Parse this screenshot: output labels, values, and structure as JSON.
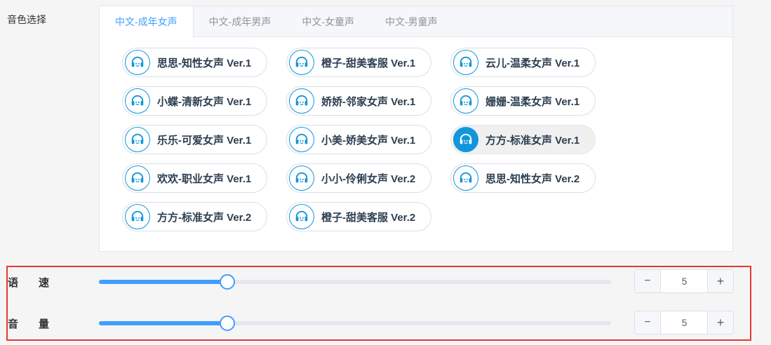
{
  "section_label": "音色选择",
  "tabs": [
    {
      "label": "中文-成年女声",
      "active": true
    },
    {
      "label": "中文-成年男声",
      "active": false
    },
    {
      "label": "中文-女童声",
      "active": false
    },
    {
      "label": "中文-男童声",
      "active": false
    }
  ],
  "voices": [
    {
      "name": "思思-知性女声 Ver.1",
      "selected": false,
      "icon": "headset-icon"
    },
    {
      "name": "橙子-甜美客服 Ver.1",
      "selected": false,
      "icon": "headset-icon"
    },
    {
      "name": "云儿-温柔女声 Ver.1",
      "selected": false,
      "icon": "headset-icon"
    },
    {
      "name": "小蝶-清新女声 Ver.1",
      "selected": false,
      "icon": "headset-icon"
    },
    {
      "name": "娇娇-邻家女声 Ver.1",
      "selected": false,
      "icon": "headset-icon"
    },
    {
      "name": "姗姗-温柔女声 Ver.1",
      "selected": false,
      "icon": "headset-icon"
    },
    {
      "name": "乐乐-可爱女声 Ver.1",
      "selected": false,
      "icon": "headset-icon"
    },
    {
      "name": "小美-娇美女声 Ver.1",
      "selected": false,
      "icon": "headset-icon"
    },
    {
      "name": "方方-标准女声 Ver.1",
      "selected": true,
      "icon": "headset-icon"
    },
    {
      "name": "欢欢-职业女声 Ver.1",
      "selected": false,
      "icon": "headset-icon"
    },
    {
      "name": "小小-伶俐女声 Ver.2",
      "selected": false,
      "icon": "headset-icon"
    },
    {
      "name": "思思-知性女声 Ver.2",
      "selected": false,
      "icon": "headset-icon"
    },
    {
      "name": "方方-标准女声 Ver.2",
      "selected": false,
      "icon": "headset-icon"
    },
    {
      "name": "橙子-甜美客服 Ver.2",
      "selected": false,
      "icon": "headset-icon"
    }
  ],
  "sliders": {
    "speed": {
      "label": "语速",
      "value": "5",
      "fraction": 0.25
    },
    "volume": {
      "label": "音量",
      "value": "5",
      "fraction": 0.25
    }
  },
  "stepper_labels": {
    "minus": "−",
    "plus": "+"
  },
  "colors": {
    "accent": "#409eff",
    "icon_blue": "#1296db",
    "highlight": "#e53935"
  }
}
